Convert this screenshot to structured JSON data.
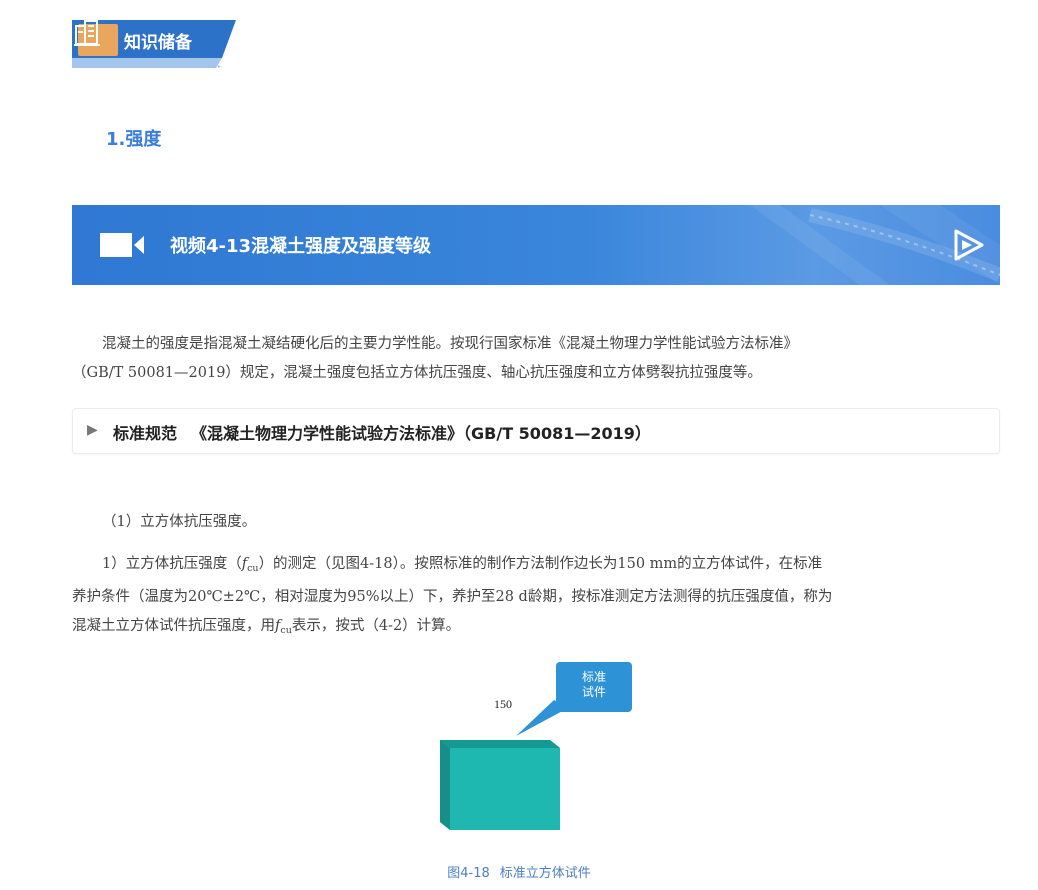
{
  "section_banner": {
    "title": "知识储备",
    "icon": "building-icon"
  },
  "heading": "1.强度",
  "video": {
    "title": "视频4-13混凝土强度及强度等级",
    "icons": [
      "video-camera-icon",
      "play-icon"
    ]
  },
  "intro": {
    "line1": "混凝土的强度是指混凝土凝结硬化后的主要力学性能。按现行国家标准《混凝土物理力学性能试验方法标准》",
    "line2": "（GB/T 50081—2019）规定，混凝土强度包括立方体抗压强度、轴心抗压强度和立方体劈裂抗拉强度等。"
  },
  "standard": {
    "label": "标准规范",
    "title": "《混凝土物理力学性能试验方法标准》（GB/T 50081—2019）"
  },
  "subsection": "（1）立方体抗压强度。",
  "body": {
    "l1_a": "1）立方体抗压强度（",
    "f_symbol": "f",
    "f_sub": "cu",
    "l1_b": "）的测定（见图4-18）。按照标准的制作方法制作边长为150 mm的立方体试件，在标准",
    "l2": "养护条件（温度为20℃±2℃，相对湿度为95%以上）下，养护至28 d龄期，按标准测定方法测得的抗压强度值，称为",
    "l3_a": "混凝土立方体试件抗压强度，用",
    "l3_b": "表示，按式（4-2）计算。"
  },
  "figure": {
    "dimension": "150",
    "callout": [
      "标准",
      "试件"
    ],
    "caption_num": "图4-18",
    "caption_text": "标准立方体试件",
    "colors": {
      "cube_front": "#1fb8b0",
      "cube_top": "#159a93",
      "cube_side": "#168f88",
      "callout": "#2e92d6"
    }
  },
  "colors": {
    "accent": "#3b7dd8",
    "video_bar": "#3a86db",
    "banner": "#2d72c9",
    "banner_icon_bg": "#e8a75c"
  }
}
